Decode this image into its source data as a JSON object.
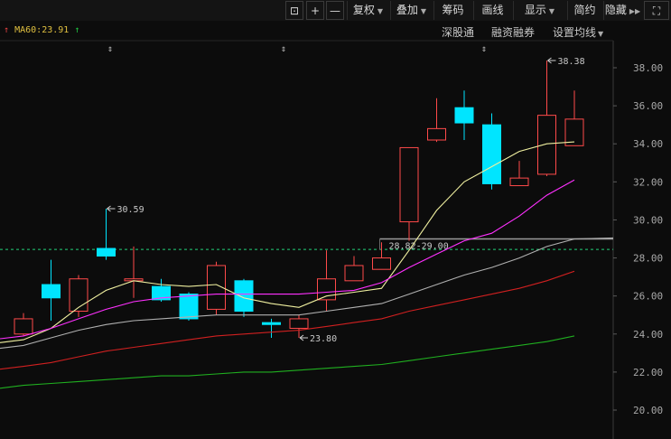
{
  "toolbar": {
    "items": [
      {
        "label": "",
        "icon": "unlock-icon"
      },
      {
        "label": "+",
        "icon": "zoom-in-icon"
      },
      {
        "label": "—",
        "icon": "zoom-out-icon"
      },
      {
        "label": "复权",
        "dropdown": true
      },
      {
        "label": "叠加",
        "dropdown": true
      },
      {
        "label": "筹码"
      },
      {
        "label": "画线"
      },
      {
        "label": "显示",
        "dropdown": true
      },
      {
        "label": "简约"
      },
      {
        "label": "隐藏"
      },
      {
        "label": "",
        "icon": "fullscreen-icon"
      }
    ]
  },
  "ma_label": {
    "name": "MA60",
    "value": "23.91"
  },
  "subtoolbar": {
    "items": [
      {
        "label": "深股通"
      },
      {
        "label": "融资融券"
      },
      {
        "label": "设置均线",
        "dropdown": true
      }
    ]
  },
  "chart_data": {
    "type": "candlestick",
    "ylim": [
      19.5,
      39.5
    ],
    "yticks": [
      "38.00",
      "36.00",
      "34.00",
      "32.00",
      "30.00",
      "28.00",
      "26.00",
      "24.00",
      "22.00",
      "20.00"
    ],
    "candles": [
      {
        "open": 24.0,
        "close": 24.8,
        "high": 25.1,
        "low": 23.9
      },
      {
        "open": 26.6,
        "close": 25.9,
        "high": 27.9,
        "low": 24.7
      },
      {
        "open": 25.2,
        "close": 26.9,
        "high": 27.1,
        "low": 24.9
      },
      {
        "open": 28.5,
        "close": 28.1,
        "high": 30.59,
        "low": 27.9
      },
      {
        "open": 26.8,
        "close": 26.9,
        "high": 28.6,
        "low": 25.9
      },
      {
        "open": 26.5,
        "close": 25.8,
        "high": 26.9,
        "low": 25.7
      },
      {
        "open": 26.1,
        "close": 24.8,
        "high": 26.2,
        "low": 24.7
      },
      {
        "open": 25.3,
        "close": 27.6,
        "high": 27.8,
        "low": 25.0
      },
      {
        "open": 26.8,
        "close": 25.2,
        "high": 26.9,
        "low": 24.9
      },
      {
        "open": 24.6,
        "close": 24.5,
        "high": 24.8,
        "low": 23.8
      },
      {
        "open": 24.3,
        "close": 24.8,
        "high": 25.0,
        "low": 23.8
      },
      {
        "open": 25.8,
        "close": 26.9,
        "high": 28.4,
        "low": 25.2
      },
      {
        "open": 26.8,
        "close": 27.6,
        "high": 28.1,
        "low": 26.8
      },
      {
        "open": 27.4,
        "close": 28.0,
        "high": 28.82,
        "low": 27.4
      },
      {
        "open": 29.9,
        "close": 33.8,
        "high": 33.8,
        "low": 28.9
      },
      {
        "open": 34.2,
        "close": 34.8,
        "high": 36.4,
        "low": 34.1
      },
      {
        "open": 35.9,
        "close": 35.1,
        "high": 36.8,
        "low": 34.2
      },
      {
        "open": 35.0,
        "close": 31.9,
        "high": 35.6,
        "low": 31.6
      },
      {
        "open": 31.8,
        "close": 32.2,
        "high": 33.1,
        "low": 31.8
      },
      {
        "open": 32.4,
        "close": 35.5,
        "high": 38.38,
        "low": 32.3
      },
      {
        "open": 33.9,
        "close": 35.3,
        "high": 36.8,
        "low": 33.9
      }
    ],
    "series": [
      {
        "values": [
          23.7,
          24.3,
          25.4,
          26.3,
          26.8,
          26.6,
          26.5,
          26.6,
          25.9,
          25.6,
          25.4,
          26.0,
          26.2,
          26.4,
          28.4,
          30.5,
          32.0,
          32.8,
          33.6,
          34.0,
          34.1
        ]
      },
      {
        "values": [
          23.9,
          24.3,
          24.8,
          25.3,
          25.7,
          25.9,
          26.0,
          26.1,
          26.1,
          26.1,
          26.1,
          26.2,
          26.3,
          26.7,
          27.5,
          28.2,
          28.9,
          29.3,
          30.2,
          31.3,
          32.1
        ]
      },
      {
        "values": [
          23.4,
          23.8,
          24.2,
          24.5,
          24.7,
          24.8,
          24.9,
          25.0,
          25.0,
          25.0,
          25.0,
          25.2,
          25.4,
          25.6,
          26.1,
          26.6,
          27.1,
          27.5,
          28.0,
          28.6,
          29.0
        ]
      },
      {
        "values": [
          22.3,
          22.5,
          22.8,
          23.1,
          23.3,
          23.5,
          23.7,
          23.9,
          24.0,
          24.1,
          24.2,
          24.4,
          24.6,
          24.8,
          25.2,
          25.5,
          25.8,
          26.1,
          26.4,
          26.8,
          27.3
        ]
      },
      {
        "values": [
          21.3,
          21.4,
          21.5,
          21.6,
          21.7,
          21.8,
          21.8,
          21.9,
          22.0,
          22.0,
          22.1,
          22.2,
          22.3,
          22.4,
          22.6,
          22.8,
          23.0,
          23.2,
          23.4,
          23.6,
          23.9
        ]
      }
    ],
    "colors": {
      "up": "#ff4a4a",
      "down": "#00e5ff",
      "ma5": "#f0f0a0",
      "ma10": "#ff30ff",
      "ma20": "#b0b0b0",
      "ma30": "#d02020",
      "ma60": "#20b020"
    },
    "reference_line": 28.45,
    "range_label": "28.82-29.00",
    "range_band": [
      28.82,
      29.0
    ],
    "annotations": [
      {
        "candle": 3,
        "value": 30.59,
        "text": "30.59"
      },
      {
        "candle": 10,
        "value": 23.8,
        "text": "23.80"
      },
      {
        "candle": 19,
        "value": 38.38,
        "text": "38.38"
      }
    ],
    "event_markers": [
      3,
      9,
      16
    ]
  }
}
